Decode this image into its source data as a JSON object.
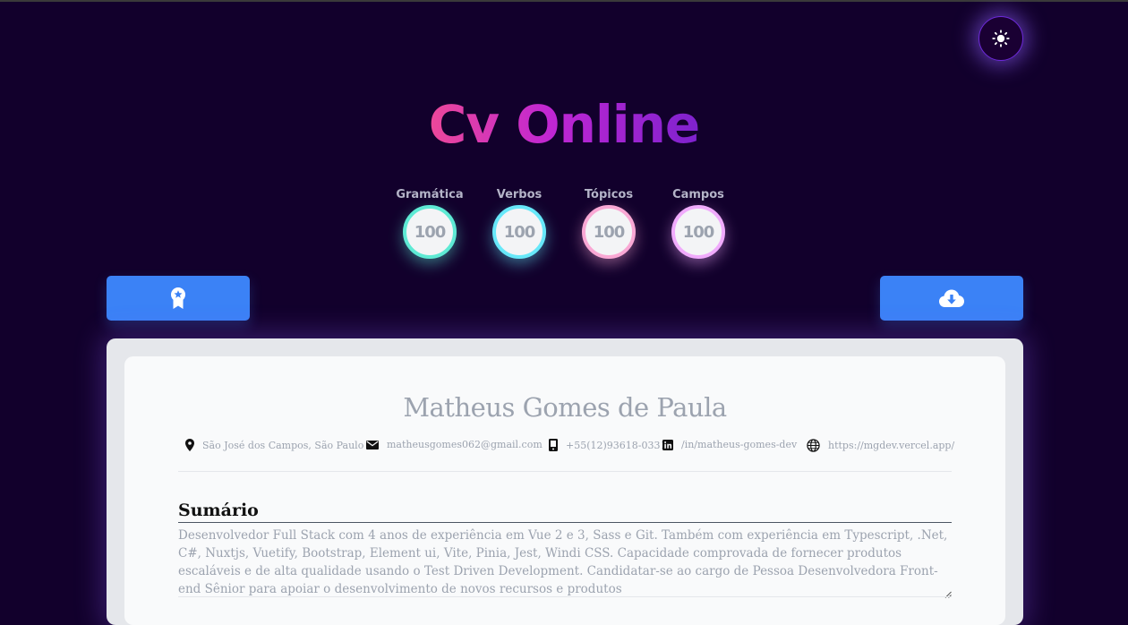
{
  "app": {
    "title": "Cv Online"
  },
  "scores": [
    {
      "label": "Gramática",
      "value": "100",
      "color": "#5eead4"
    },
    {
      "label": "Verbos",
      "value": "100",
      "color": "#67e8f9"
    },
    {
      "label": "Tópicos",
      "value": "100",
      "color": "#f9a8d4"
    },
    {
      "label": "Campos",
      "value": "100",
      "color": "#f0abfc"
    }
  ],
  "colors": {
    "background": "#12002c",
    "button": "#3b82f6",
    "title_gradient": [
      "#ec4899",
      "#7e22ce"
    ]
  },
  "icons": {
    "theme": "sun-icon",
    "left_button": "award-badge-icon",
    "right_button": "cloud-download-icon"
  },
  "cv": {
    "name": "Matheus Gomes de Paula",
    "contacts": [
      {
        "icon": "location-pin-icon",
        "text": "São José dos Campos, São Paulo"
      },
      {
        "icon": "mail-icon",
        "text": "matheusgomes062@gmail.com"
      },
      {
        "icon": "phone-icon",
        "text": "+55(12)93618-0331"
      },
      {
        "icon": "linkedin-icon",
        "text": "/in/matheus-gomes-dev"
      },
      {
        "icon": "globe-icon",
        "text": "https://mgdev.vercel.app/"
      }
    ],
    "summary": {
      "title": "Sumário",
      "text": "Desenvolvedor Full Stack com 4 anos de experiência em Vue 2 e 3, Sass e Git. Também com experiência em Typescript, .Net, C#, Nuxtjs, Vuetify, Bootstrap, Element ui, Vite, Pinia, Jest, Windi CSS. Capacidade comprovada de fornecer produtos escaláveis e de alta qualidade usando o Test Driven Development. Candidatar-se ao cargo de Pessoa Desenvolvedora Front-end Sênior para apoiar o desenvolvimento de novos recursos e produtos"
    }
  }
}
